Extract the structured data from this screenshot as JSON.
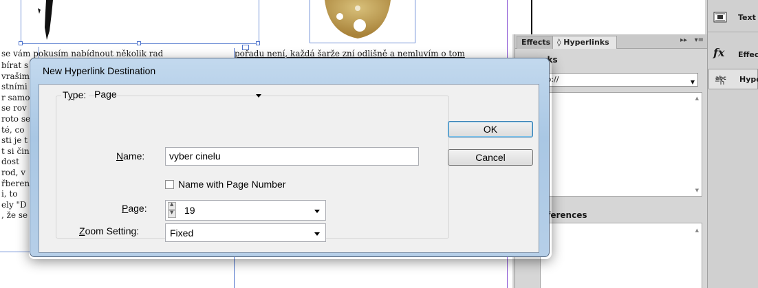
{
  "document": {
    "top_left_text": "se vám pokusím nabídnout několik rad",
    "top_right_text": "pořadu není, každá šarže zní odlišně a nemluvím o tom",
    "left_column_lines": [
      "bírat s",
      "vrašim",
      "stními",
      "r samo",
      "se rov",
      "roto se",
      "té, co",
      "sti je t",
      "t si čin",
      "dost",
      "rod, v",
      "řberen",
      "i, to",
      "ely \"D",
      ", že se"
    ]
  },
  "panels": {
    "tabs": [
      "Effects",
      "Hyperlinks"
    ],
    "collapse_glyph": "▸▸",
    "menu_glyph": "▾≡",
    "hyperlinks_title": "nks",
    "url_value": "tp://",
    "cross_references_title": "eferences",
    "dock": [
      {
        "icon": "text-wrap-icon",
        "label": "Text"
      },
      {
        "icon": "fx-icon",
        "label": "Effec"
      },
      {
        "icon": "hyperlink-icon",
        "label": "Hype"
      }
    ]
  },
  "dialog": {
    "title": "New Hyperlink Destination",
    "type_label": "Type:",
    "type_value": "Page",
    "name_label": "Name:",
    "name_value": "vyber cinelu",
    "name_with_page_number_label": "Name with Page Number",
    "name_with_page_number_checked": false,
    "page_label": "Page:",
    "page_value": "19",
    "zoom_label": "Zoom Setting:",
    "zoom_value": "Fixed",
    "ok_label": "OK",
    "cancel_label": "Cancel"
  }
}
